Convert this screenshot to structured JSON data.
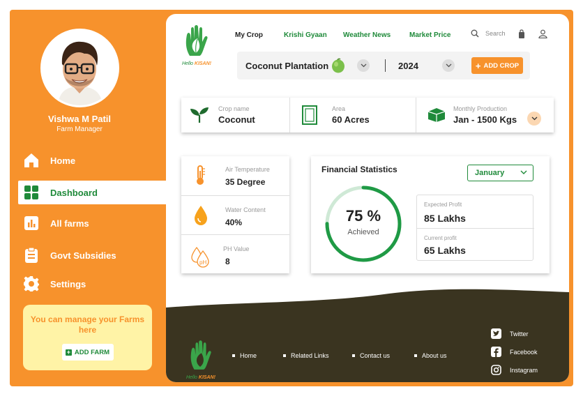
{
  "user": {
    "name": "Vishwa M Patil",
    "role": "Farm Manager"
  },
  "sidebar": {
    "items": [
      {
        "label": "Home",
        "icon": "home-icon"
      },
      {
        "label": "Dashboard",
        "icon": "dashboard-icon"
      },
      {
        "label": "All farms",
        "icon": "bar-chart-icon"
      },
      {
        "label": "Govt Subsidies",
        "icon": "clipboard-icon"
      },
      {
        "label": "Settings",
        "icon": "gear-icon"
      }
    ],
    "active": "Dashboard"
  },
  "promo": {
    "text": "You can manage your Farms here",
    "button": "ADD FARM"
  },
  "brand": {
    "hello": "Hello",
    "name": "KISAN!"
  },
  "topnav": {
    "my_crop": "My Crop",
    "krishi": "Krishi Gyaan",
    "weather": "Weather News",
    "market": "Market Price",
    "search_placeholder": "Search"
  },
  "cropbar": {
    "crop": "Coconut Plantation",
    "year": "2024",
    "add_button": "ADD CROP"
  },
  "info": {
    "crop_label": "Crop name",
    "crop_value": "Coconut",
    "area_label": "Area",
    "area_value": "60 Acres",
    "prod_label": "Monthly Production",
    "prod_value": "Jan - 1500 Kgs"
  },
  "stats": [
    {
      "label": "Air Temperature",
      "value": "35 Degree",
      "icon": "thermometer-icon"
    },
    {
      "label": "Water Content",
      "value": "40%",
      "icon": "water-drop-icon"
    },
    {
      "label": "PH Value",
      "value": "8",
      "icon": "ph-drops-icon"
    }
  ],
  "finance": {
    "title": "Financial Statistics",
    "month": "January",
    "percent": "75 %",
    "progress": 0.75,
    "achieved": "Achieved",
    "expected_label": "Expected Profit",
    "expected_value": "85 Lakhs",
    "current_label": "Current profit",
    "current_value": "65 Lakhs"
  },
  "footer": {
    "links": [
      "Home",
      "Related Links",
      "Contact us",
      "About us"
    ],
    "social": [
      {
        "label": "Twitter",
        "icon": "twitter-icon"
      },
      {
        "label": "Facebook",
        "icon": "facebook-icon"
      },
      {
        "label": "Instagram",
        "icon": "instagram-icon"
      }
    ]
  },
  "colors": {
    "orange": "#F7922C",
    "green": "#1F8A3A",
    "dark": "#3A3420",
    "promo_bg": "#FFF3A6"
  }
}
